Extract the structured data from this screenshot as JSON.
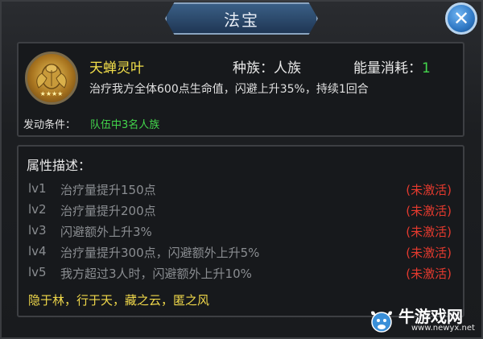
{
  "window": {
    "title": "法宝",
    "close_icon": "close-x-icon"
  },
  "item": {
    "name": "天蝉灵叶",
    "race_label": "种族：人族",
    "energy_label": "能量消耗：",
    "energy_value": "1",
    "description": "治疗我方全体600点生命值，闪避上升35%，持续1回合",
    "stars": "★★★★",
    "condition_label": "发动条件：",
    "condition_value": "队伍中3名人族"
  },
  "attributes": {
    "title": "属性描述：",
    "rows": [
      {
        "level": "lv1",
        "text": "治疗量提升150点",
        "status": "(未激活)"
      },
      {
        "level": "lv2",
        "text": "治疗量提升200点",
        "status": "(未激活)"
      },
      {
        "level": "lv3",
        "text": "闪避额外上升3%",
        "status": "(未激活)"
      },
      {
        "level": "lv4",
        "text": "治疗量提升300点，闪避额外上升5%",
        "status": "(未激活)"
      },
      {
        "level": "lv5",
        "text": "我方超过3人时，闪避额外上升10%",
        "status": "(未激活)"
      }
    ],
    "motto": "隐于林，行于天，藏之云，匿之风"
  },
  "watermark": {
    "text": "牛游戏网",
    "url": "www.newyx.net"
  },
  "colors": {
    "accent_yellow": "#f4e04a",
    "green": "#43d64c",
    "red": "#e43a2e",
    "gray": "#8a8d91",
    "title_blue": "#2f5a85"
  }
}
